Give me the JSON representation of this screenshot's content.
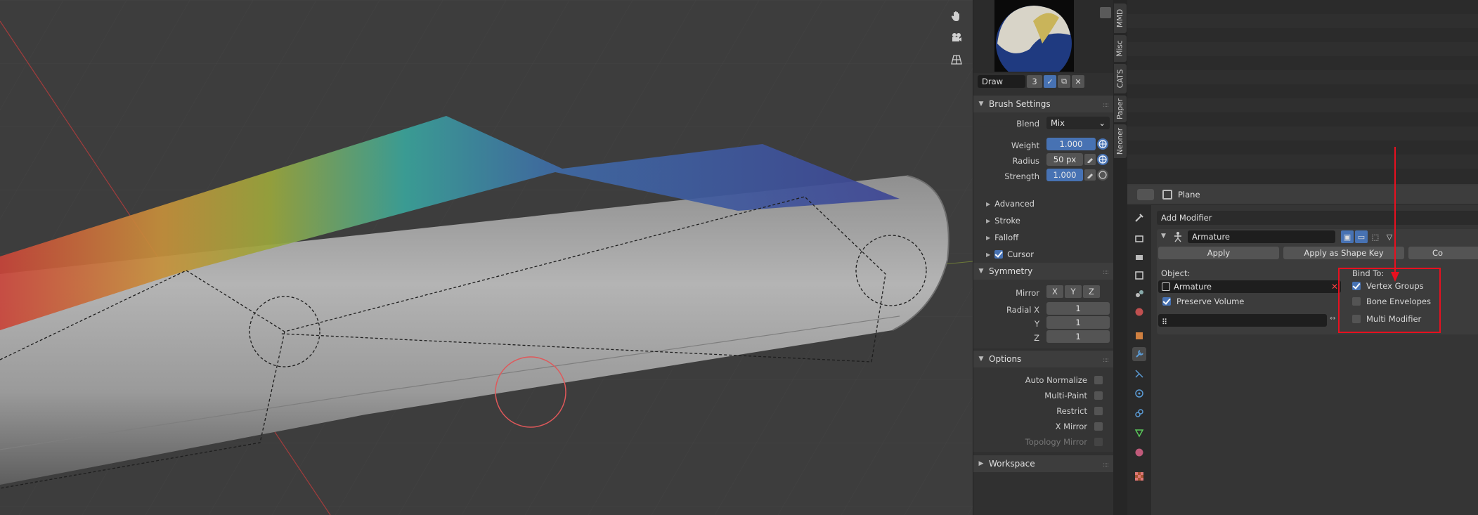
{
  "sidebar": {
    "brush": {
      "name": "Draw",
      "users": "3"
    },
    "brush_settings": {
      "title": "Brush Settings",
      "blend_label": "Blend",
      "blend_value": "Mix",
      "weight_label": "Weight",
      "weight_value": "1.000",
      "radius_label": "Radius",
      "radius_value": "50 px",
      "strength_label": "Strength",
      "strength_value": "1.000",
      "subpanels": [
        "Advanced",
        "Stroke",
        "Falloff",
        "Cursor"
      ]
    },
    "symmetry": {
      "title": "Symmetry",
      "mirror_label": "Mirror",
      "axes": [
        "X",
        "Y",
        "Z"
      ],
      "radial_x_label": "Radial X",
      "radial_x": "1",
      "radial_y_label": "Y",
      "radial_y": "1",
      "radial_z_label": "Z",
      "radial_z": "1"
    },
    "options": {
      "title": "Options",
      "items": [
        "Auto Normalize",
        "Multi-Paint",
        "Restrict",
        "X Mirror",
        "Topology Mirror"
      ]
    },
    "workspace": {
      "title": "Workspace"
    }
  },
  "vertical_tabs": [
    "MMD",
    "Misc",
    "CATS",
    "Paper",
    "Neoner"
  ],
  "properties": {
    "object_name": "Plane",
    "add_modifier": "Add Modifier",
    "modifier_name": "Armature",
    "apply": "Apply",
    "apply_shape_key": "Apply as Shape Key",
    "copy_partial": "Co",
    "object_label": "Object:",
    "object_value": "Armature",
    "preserve_volume": "Preserve Volume",
    "bind_to_label": "Bind To:",
    "vertex_groups": "Vertex Groups",
    "bone_envelopes": "Bone Envelopes",
    "multi_modifier": "Multi Modifier"
  },
  "colors": {
    "accent": "#4772b3",
    "annotation": "#e8101f"
  }
}
